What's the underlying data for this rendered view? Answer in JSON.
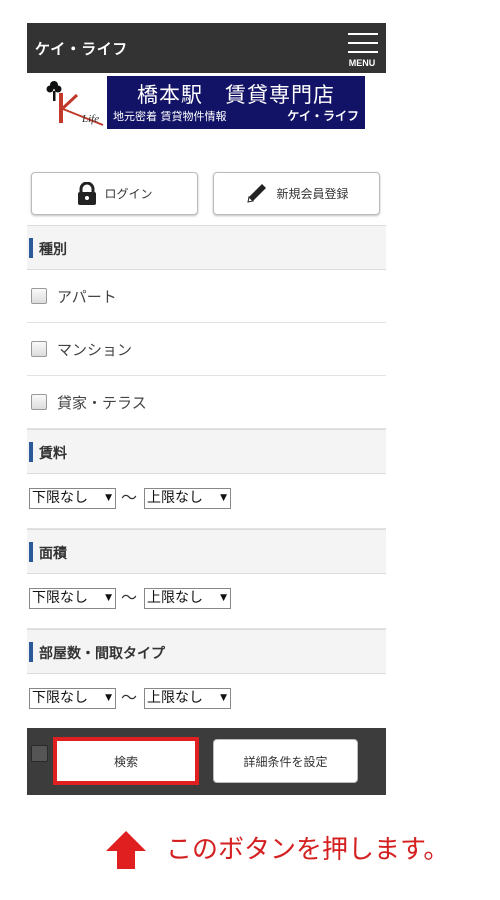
{
  "header": {
    "brand": "ケイ・ライフ",
    "menu_label": "MENU"
  },
  "banner": {
    "logo_text": "Life",
    "title": "橋本駅　賃貸専門店",
    "subtitle": "地元密着 賃貸物件情報",
    "brand": "ケイ・ライフ"
  },
  "auth": {
    "login_label": "ログイン",
    "register_label": "新規会員登録"
  },
  "sections": {
    "type": {
      "title": "種別",
      "options": [
        "アパート",
        "マンション",
        "貸家・テラス"
      ]
    },
    "rent": {
      "title": "賃料",
      "min": "下限なし",
      "max": "上限なし"
    },
    "area": {
      "title": "面積",
      "min": "下限なし",
      "max": "上限なし"
    },
    "rooms": {
      "title": "部屋数・間取タイプ",
      "min": "下限なし",
      "max": "上限なし"
    }
  },
  "actions": {
    "search_label": "検索",
    "detail_label": "詳細条件を設定"
  },
  "annotation": {
    "text": "このボタンを押します。"
  },
  "colors": {
    "header_bg": "#333333",
    "banner_bg": "#121266",
    "section_marker": "#2a5a9a",
    "highlight_red": "#e02020"
  }
}
